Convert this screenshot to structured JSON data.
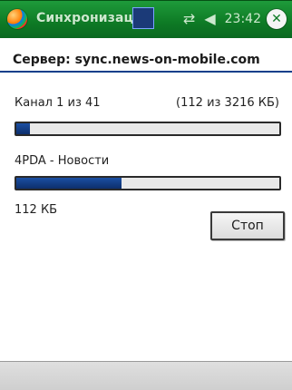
{
  "titlebar": {
    "title": "Синхронизация",
    "time": "23:42",
    "sync_glyph": "⇄",
    "volume_glyph": "◀",
    "close_label": "✕",
    "colors": {
      "bg": "#0e7a25"
    }
  },
  "header": {
    "server_text": "Сервер: sync.news-on-mobile.com"
  },
  "main": {
    "channel_progress_text": "Канал 1 из 41",
    "size_progress_text": "(112 из 3216 КБ)",
    "progress1": 0.05,
    "item_label": "4PDA - Новости",
    "progress2": 0.4,
    "size_label": "112 КБ",
    "stop_button": "Стоп"
  }
}
